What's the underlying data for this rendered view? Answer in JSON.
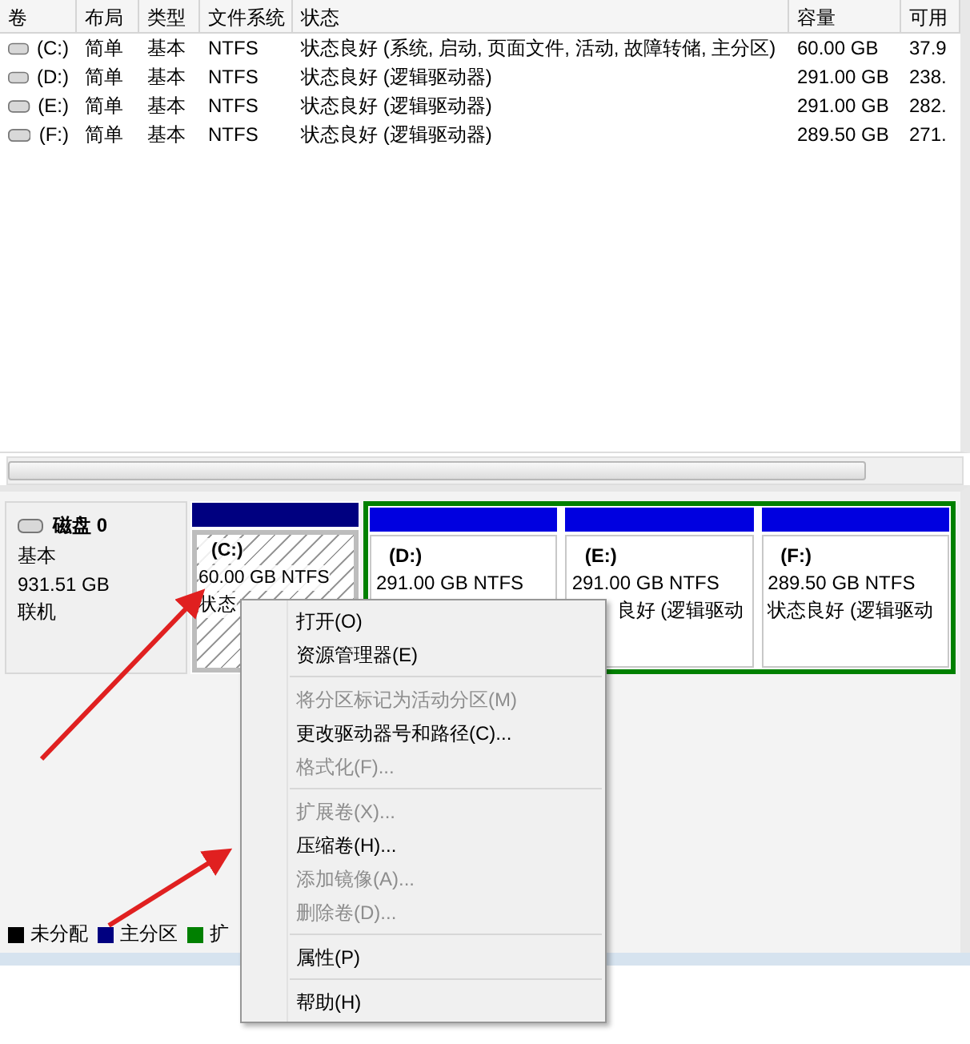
{
  "volume_table": {
    "columns": [
      "卷",
      "布局",
      "类型",
      "文件系统",
      "状态",
      "容量",
      "可用"
    ],
    "rows": [
      {
        "cells": [
          "(C:)",
          "简单",
          "基本",
          "NTFS",
          "状态良好 (系统, 启动, 页面文件, 活动, 故障转储, 主分区)",
          "60.00 GB",
          "37.9"
        ]
      },
      {
        "cells": [
          "(D:)",
          "简单",
          "基本",
          "NTFS",
          "状态良好 (逻辑驱动器)",
          "291.00 GB",
          "238."
        ]
      },
      {
        "cells": [
          "(E:)",
          "简单",
          "基本",
          "NTFS",
          "状态良好 (逻辑驱动器)",
          "291.00 GB",
          "282."
        ]
      },
      {
        "cells": [
          "(F:)",
          "简单",
          "基本",
          "NTFS",
          "状态良好 (逻辑驱动器)",
          "289.50 GB",
          "271."
        ]
      }
    ]
  },
  "disk": {
    "name": "磁盘 0",
    "type": "基本",
    "size": "931.51 GB",
    "status": "联机"
  },
  "partitions": [
    {
      "kind": "primary",
      "label": "(C:)",
      "size": "60.00 GB NTFS",
      "status": "状态"
    },
    {
      "kind": "logical",
      "label": "(D:)",
      "size": "291.00 GB NTFS"
    },
    {
      "kind": "logical",
      "label": "(E:)",
      "size": "291.00 GB NTFS",
      "status": "良好 (逻辑驱动"
    },
    {
      "kind": "logical",
      "label": "(F:)",
      "size": "289.50 GB NTFS",
      "status": "状态良好 (逻辑驱动"
    }
  ],
  "legend": [
    {
      "label": "未分配",
      "color": "#000000"
    },
    {
      "label": "主分区",
      "color": "#000080"
    },
    {
      "label": "扩",
      "color": "#008000"
    }
  ],
  "context_menu": [
    {
      "kind": "item",
      "label": "打开(O)",
      "disabled": false
    },
    {
      "kind": "item",
      "label": "资源管理器(E)",
      "disabled": false
    },
    {
      "kind": "separator"
    },
    {
      "kind": "item",
      "label": "将分区标记为活动分区(M)",
      "disabled": true
    },
    {
      "kind": "item",
      "label": "更改驱动器号和路径(C)...",
      "disabled": false
    },
    {
      "kind": "item",
      "label": "格式化(F)...",
      "disabled": true
    },
    {
      "kind": "separator"
    },
    {
      "kind": "item",
      "label": "扩展卷(X)...",
      "disabled": true
    },
    {
      "kind": "item",
      "label": "压缩卷(H)...",
      "disabled": false
    },
    {
      "kind": "item",
      "label": "添加镜像(A)...",
      "disabled": true
    },
    {
      "kind": "item",
      "label": "删除卷(D)...",
      "disabled": true
    },
    {
      "kind": "separator"
    },
    {
      "kind": "item",
      "label": "属性(P)",
      "disabled": false
    },
    {
      "kind": "separator"
    },
    {
      "kind": "item",
      "label": "帮助(H)",
      "disabled": false
    }
  ]
}
